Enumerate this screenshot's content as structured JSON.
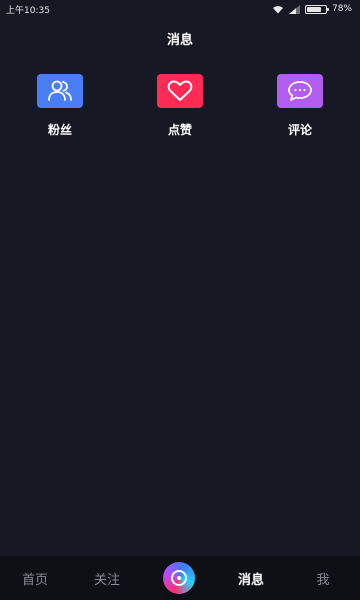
{
  "status_bar": {
    "time": "上午10:35",
    "battery_text": "78%",
    "battery_level": 0.78
  },
  "header": {
    "title": "消息"
  },
  "categories": [
    {
      "label": "粉丝",
      "icon": "fans-icon",
      "color": "#4a7ef7"
    },
    {
      "label": "点赞",
      "icon": "heart-icon",
      "color": "#fe2c55"
    },
    {
      "label": "评论",
      "icon": "comment-icon",
      "color": "#b35cf0"
    }
  ],
  "tab_bar": {
    "tabs": [
      {
        "label": "首页"
      },
      {
        "label": "关注"
      },
      {
        "label": "消息",
        "active": true
      },
      {
        "label": "我"
      }
    ],
    "center_button_icon": "camera-icon"
  }
}
